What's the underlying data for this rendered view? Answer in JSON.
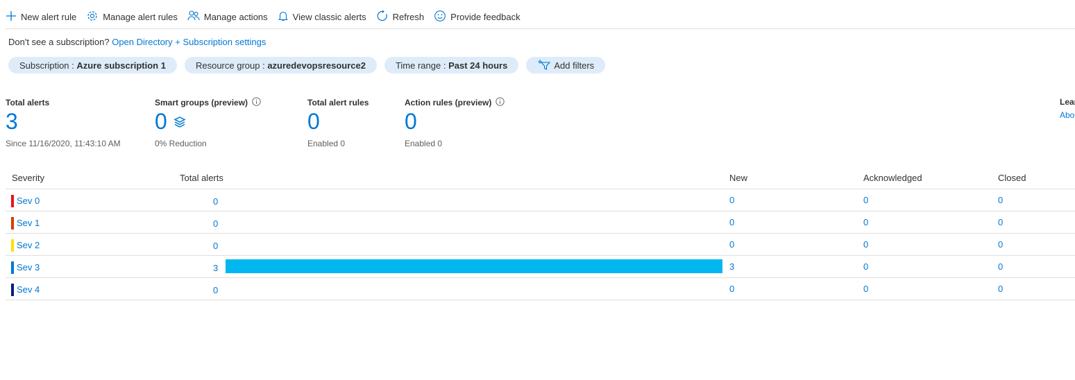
{
  "toolbar": {
    "new_alert_rule": "New alert rule",
    "manage_alert_rules": "Manage alert rules",
    "manage_actions": "Manage actions",
    "view_classic_alerts": "View classic alerts",
    "refresh": "Refresh",
    "provide_feedback": "Provide feedback"
  },
  "subscription_notice": {
    "text": "Don't see a subscription?",
    "link": "Open Directory + Subscription settings"
  },
  "filters": {
    "subscription": {
      "label": "Subscription : ",
      "value": "Azure subscription 1"
    },
    "resource_group": {
      "label": "Resource group : ",
      "value": "azuredevopsresource2"
    },
    "time_range": {
      "label": "Time range : ",
      "value": "Past 24 hours"
    },
    "add_filters": "Add filters"
  },
  "metrics": {
    "total_alerts": {
      "title": "Total alerts",
      "value": "3",
      "sub": "Since 11/16/2020, 11:43:10 AM"
    },
    "smart_groups": {
      "title": "Smart groups (preview)",
      "value": "0",
      "sub": "0% Reduction"
    },
    "total_alert_rules": {
      "title": "Total alert rules",
      "value": "0",
      "sub": "Enabled 0"
    },
    "action_rules": {
      "title": "Action rules (preview)",
      "value": "0",
      "sub": "Enabled 0"
    },
    "learn": {
      "title": "Lear",
      "link": "Abo"
    }
  },
  "table": {
    "headers": {
      "severity": "Severity",
      "total": "Total alerts",
      "new": "New",
      "acknowledged": "Acknowledged",
      "closed": "Closed"
    },
    "max_total": 3,
    "rows": [
      {
        "severity": "Sev 0",
        "color": "#e81123",
        "total": "0",
        "total_value": 0,
        "new": "0",
        "acknowledged": "0",
        "closed": "0"
      },
      {
        "severity": "Sev 1",
        "color": "#d83b01",
        "total": "0",
        "total_value": 0,
        "new": "0",
        "acknowledged": "0",
        "closed": "0"
      },
      {
        "severity": "Sev 2",
        "color": "#fce100",
        "total": "0",
        "total_value": 0,
        "new": "0",
        "acknowledged": "0",
        "closed": "0"
      },
      {
        "severity": "Sev 3",
        "color": "#0078d4",
        "total": "3",
        "total_value": 3,
        "new": "3",
        "acknowledged": "0",
        "closed": "0"
      },
      {
        "severity": "Sev 4",
        "color": "#001f7a",
        "total": "0",
        "total_value": 0,
        "new": "0",
        "acknowledged": "0",
        "closed": "0"
      }
    ]
  }
}
